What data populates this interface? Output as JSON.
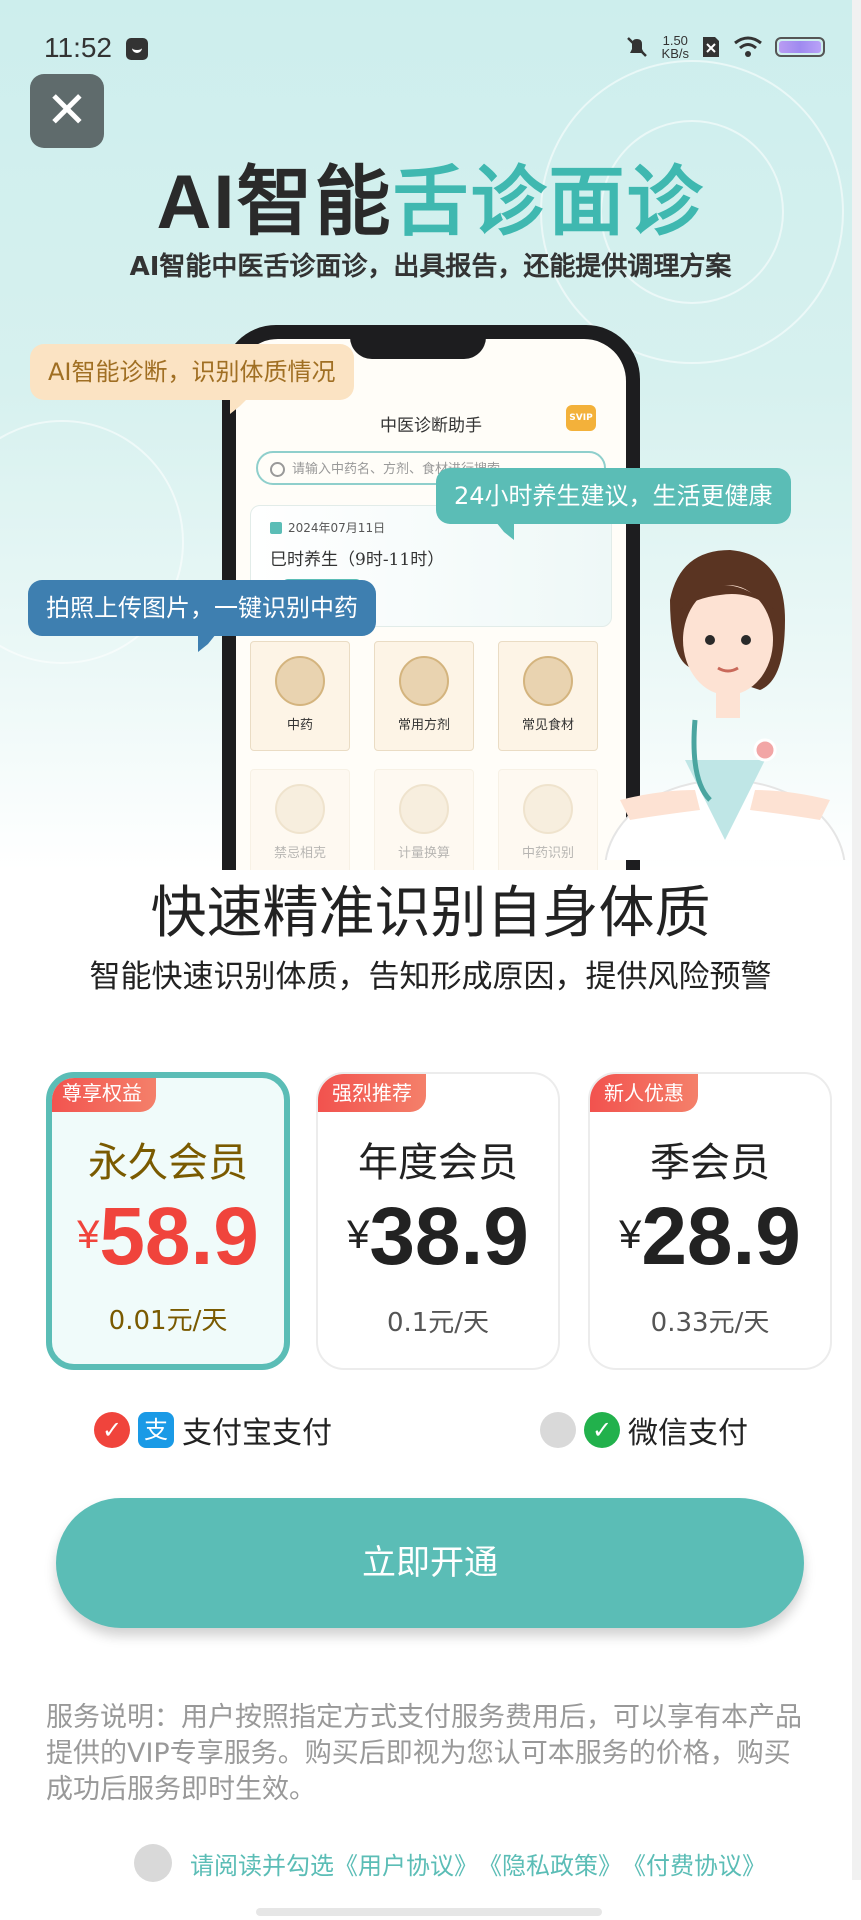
{
  "status_bar": {
    "time": "11:52",
    "net_speed_value": "1.50",
    "net_speed_unit": "KB/s",
    "icons": [
      "message-icon",
      "mute-bell-icon",
      "sim-off-icon",
      "wifi-icon",
      "battery-icon"
    ]
  },
  "hero": {
    "title_part1": "AI智能",
    "title_part2": "舌诊面诊",
    "subtitle": "AI智能中医舌诊面诊，出具报告，还能提供调理方案",
    "bubble_1": "AI智能诊断，识别体质情况",
    "bubble_2": "24小时养生建议，生活更健康",
    "bubble_3": "拍照上传图片，一键识别中药",
    "phone": {
      "app_title": "中医诊断助手",
      "badge": "SVIP",
      "search_placeholder": "请输入中药名、方剂、食材进行搜索",
      "date": "2024年07月11日",
      "period": "巳时养生（9时-11时）",
      "tiles": [
        "中药",
        "常用方剂",
        "常见食材",
        "禁忌相克",
        "计量换算",
        "中药识别"
      ]
    }
  },
  "section": {
    "title": "快速精准识别自身体质",
    "subtitle": "智能快速识别体质，告知形成原因，提供风险预警"
  },
  "plans": [
    {
      "tag": "尊享权益",
      "name": "永久会员",
      "currency": "¥",
      "price": "58.9",
      "per_day": "0.01元/天",
      "selected": true
    },
    {
      "tag": "强烈推荐",
      "name": "年度会员",
      "currency": "¥",
      "price": "38.9",
      "per_day": "0.1元/天",
      "selected": false
    },
    {
      "tag": "新人优惠",
      "name": "季会员",
      "currency": "¥",
      "price": "28.9",
      "per_day": "0.33元/天",
      "selected": false
    }
  ],
  "payment": {
    "alipay_label": "支付宝支付",
    "alipay_selected": true,
    "wechat_label": "微信支付",
    "wechat_selected": false
  },
  "cta_label": "立即开通",
  "service_note": "服务说明：用户按照指定方式支付服务费用后，可以享有本产品提供的VIP专享服务。购买后即视为您认可本服务的价格，购买成功后服务即时生效。",
  "agreement": {
    "prefix": "请阅读并勾选",
    "user_agreement": "《用户协议》",
    "privacy_policy": "《隐私政策》",
    "payment_agreement": "《付费协议》"
  },
  "colors": {
    "accent": "#5bbdb6",
    "price_red": "#f0443c",
    "gold_text": "#7a5a00",
    "hero_bg": "#cdeeed"
  }
}
